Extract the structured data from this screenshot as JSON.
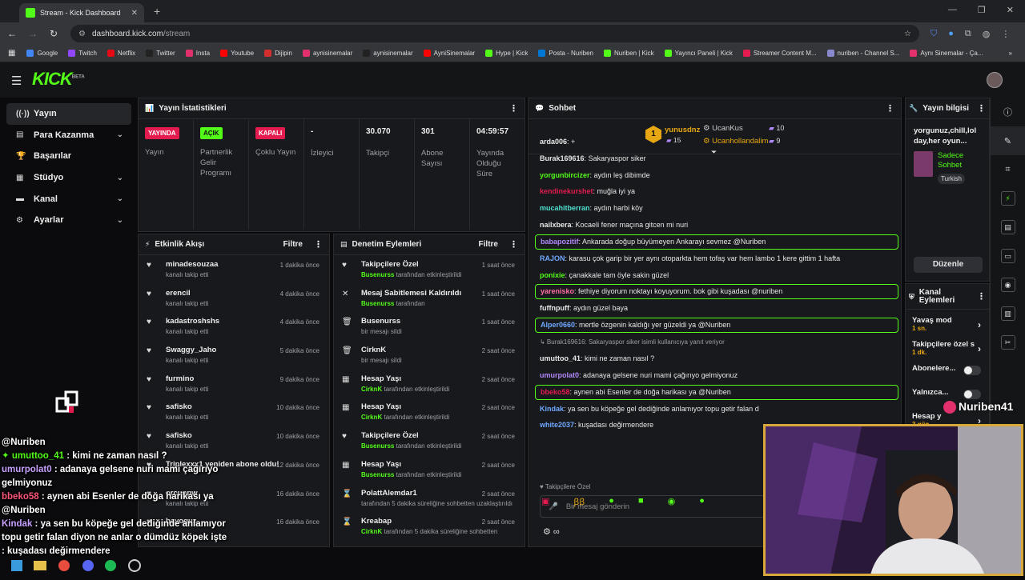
{
  "browser": {
    "tab_title": "Stream - Kick Dashboard",
    "url_host": "dashboard.kick.com",
    "url_path": "/stream",
    "bookmarks": [
      {
        "label": "Google",
        "color": "#4285f4"
      },
      {
        "label": "Twitch",
        "color": "#9146ff"
      },
      {
        "label": "Netflix",
        "color": "#e50914"
      },
      {
        "label": "Twitter",
        "color": "#222222"
      },
      {
        "label": "Insta",
        "color": "#e1306c"
      },
      {
        "label": "Youtube",
        "color": "#ff0000"
      },
      {
        "label": "Dijipin",
        "color": "#d32f2f"
      },
      {
        "label": "aynisinemalar",
        "color": "#e1306c"
      },
      {
        "label": "aynisinemalar",
        "color": "#222222"
      },
      {
        "label": "AyniSinemalar",
        "color": "#ff0000"
      },
      {
        "label": "Hype | Kick",
        "color": "#53fc18"
      },
      {
        "label": "Posta - Nuriben",
        "color": "#0078d4"
      },
      {
        "label": "Nuriben | Kick",
        "color": "#53fc18"
      },
      {
        "label": "Yayıncı Paneli | Kick",
        "color": "#53fc18"
      },
      {
        "label": "Streamer Content M...",
        "color": "#e41b4f"
      },
      {
        "label": "nuriben - Channel S...",
        "color": "#8888cc"
      },
      {
        "label": "Aynı Sinemalar - Ça...",
        "color": "#e1306c"
      }
    ]
  },
  "app": {
    "logo": "KICK",
    "logo_sup": "BETA",
    "sidebar": [
      {
        "label": "Yayın",
        "icon": "broadcast-icon",
        "glyph": "((·))",
        "chevron": false,
        "active": true
      },
      {
        "label": "Para Kazanma",
        "icon": "money-icon",
        "glyph": "▤",
        "chevron": true
      },
      {
        "label": "Başarılar",
        "icon": "trophy-icon",
        "glyph": "🏆",
        "chevron": false
      },
      {
        "label": "Stüdyo",
        "icon": "studio-icon",
        "glyph": "▦",
        "chevron": true
      },
      {
        "label": "Kanal",
        "icon": "channel-icon",
        "glyph": "▬",
        "chevron": true
      },
      {
        "label": "Ayarlar",
        "icon": "gear-icon",
        "glyph": "⚙",
        "chevron": true
      }
    ]
  },
  "stats_panel": {
    "title": "Yayın İstatistikleri",
    "cells": [
      {
        "badge": "YAYINDA",
        "badge_color": "red",
        "label": "Yayın"
      },
      {
        "badge": "AÇIK",
        "badge_color": "green",
        "label": "Partnerlik Gelir Programı"
      },
      {
        "badge": "KAPALI",
        "badge_color": "red",
        "label": "Çoklu Yayın"
      },
      {
        "value": "-",
        "label": "İzleyici"
      },
      {
        "value": "30.070",
        "label": "Takipçi"
      },
      {
        "value": "301",
        "label": "Abone Sayısı"
      },
      {
        "value": "04:59:57",
        "label": "Yayında Olduğu Süre"
      }
    ]
  },
  "activity_feed": {
    "title": "Etkinlik Akışı",
    "filter_label": "Filtre",
    "items": [
      {
        "name": "minadesouzaa",
        "sub": "kanalı takip etti",
        "time": "1 dakika önce"
      },
      {
        "name": "erencil",
        "sub": "kanalı takip etti",
        "time": "4 dakika önce"
      },
      {
        "name": "kadastroshshs",
        "sub": "kanalı takip etti",
        "time": "4 dakika önce"
      },
      {
        "name": "Swaggy_Jaho",
        "sub": "kanalı takip etti",
        "time": "5 dakika önce"
      },
      {
        "name": "furmino",
        "sub": "kanalı takip etti",
        "time": "9 dakika önce"
      },
      {
        "name": "safisko",
        "sub": "kanalı takip etti",
        "time": "10 dakika önce"
      },
      {
        "name": "safisko",
        "sub": "kanalı takip etti",
        "time": "10 dakika önce"
      },
      {
        "name": "Triplexxx1 yeniden abone oldu!",
        "sub": "",
        "time": "12 dakika önce"
      },
      {
        "name": "orcunpw",
        "sub": "kanalı takip etti",
        "time": "16 dakika önce"
      },
      {
        "name": "bayoguz",
        "sub": "",
        "time": "16 dakika önce"
      }
    ]
  },
  "mod_actions": {
    "title": "Denetim Eylemleri",
    "filter_label": "Filtre",
    "items": [
      {
        "name": "Takipçilere Özel",
        "actor": "Busenurss",
        "sub": "tarafından etkinleştirildi",
        "time": "1 saat önce",
        "glyph": "♥",
        "icon": "heart-icon"
      },
      {
        "name": "Mesaj Sabitlemesi Kaldırıldı",
        "actor": "Busenurss",
        "sub": "tarafından",
        "time": "1 saat önce",
        "glyph": "✕",
        "icon": "unpin-icon"
      },
      {
        "name": "Busenurss",
        "actor": "",
        "sub": "bir mesajı sildi",
        "time": "1 saat önce",
        "glyph": "🗑",
        "icon": "trash-icon"
      },
      {
        "name": "CirknK",
        "actor": "",
        "sub": "bir mesajı sildi",
        "time": "2 saat önce",
        "glyph": "🗑",
        "icon": "trash-icon"
      },
      {
        "name": "Hesap Yaşı",
        "actor": "CirknK",
        "sub": "tarafından etkinleştirildi",
        "time": "2 saat önce",
        "glyph": "▦",
        "icon": "calendar-icon"
      },
      {
        "name": "Hesap Yaşı",
        "actor": "CirknK",
        "sub": "tarafından etkinleştirildi",
        "time": "2 saat önce",
        "glyph": "▦",
        "icon": "calendar-icon"
      },
      {
        "name": "Takipçilere Özel",
        "actor": "Busenurss",
        "sub": "tarafından etkinleştirildi",
        "time": "2 saat önce",
        "glyph": "♥",
        "icon": "heart-icon"
      },
      {
        "name": "Hesap Yaşı",
        "actor": "Busenurss",
        "sub": "tarafından etkinleştirildi",
        "time": "2 saat önce",
        "glyph": "▦",
        "icon": "calendar-icon"
      },
      {
        "name": "PolattAlemdar1",
        "actor": "",
        "sub": "tarafından 5 dakika süreliğine sohbetten uzaklaştırıldı",
        "time": "2 saat önce",
        "glyph": "⌛",
        "icon": "hourglass-icon"
      },
      {
        "name": "Kreabap",
        "actor": "CirknK",
        "sub": "tarafından 5 dakika süreliğine sohbetten",
        "time": "2 saat önce",
        "glyph": "⌛",
        "icon": "hourglass-icon"
      }
    ]
  },
  "chat": {
    "title": "Sohbet",
    "gifters": [
      {
        "name": "yunusdnz",
        "count": "15",
        "rank": "1"
      },
      {
        "name": "UcanKus",
        "count": "10"
      },
      {
        "name": "Ucanhollandalim",
        "count": "9"
      }
    ],
    "messages": [
      {
        "user": "arda006",
        "text": "+",
        "color": "#e7e7e7",
        "hl": false
      },
      {
        "user": "Burak169616",
        "text": "Sakaryaspor siker",
        "color": "#e7e7e7",
        "hl": false
      },
      {
        "user": "yorgunbircizer",
        "text": "aydın leş dibimde",
        "color": "#53fc18",
        "hl": false
      },
      {
        "user": "kendinekurshet",
        "text": "muğla iyi ya",
        "color": "#e41b4f",
        "hl": false
      },
      {
        "user": "mucahitberran",
        "text": "aydın harbi köy",
        "color": "#4ee0d0",
        "hl": false
      },
      {
        "user": "nailxbera",
        "text": "Kocaeli fener maçına gitcen mi nuri",
        "color": "#e7e7e7",
        "hl": false
      },
      {
        "user": "babapozitif",
        "text": "Ankarada doğup büyümeyen Ankarayı sevmez @Nuriben",
        "color": "#b088f9",
        "hl": true
      },
      {
        "user": "RAJON",
        "text": "karasu çok garip bir yer aynı otoparkta hem tofaş var hem lambo 1 kere gittim 1 hafta",
        "color": "#6fa8ff",
        "hl": false
      },
      {
        "user": "ponixie",
        "text": "çanakkale tam öyle sakin güzel",
        "color": "#53fc18",
        "hl": false
      },
      {
        "user": "yarenisko",
        "text": "fethiye diyorum noktayı koyuyorum. bok gibi kuşadası @nuriben",
        "color": "#ff6fa8",
        "hl": true
      },
      {
        "user": "fuffnpuff",
        "text": "aydın güzel baya",
        "color": "#e7e7e7",
        "hl": false
      },
      {
        "user": "Alper0660",
        "text": "mertle özgenin kaldığı yer güzeldi ya @Nuriben",
        "color": "#6fa8ff",
        "hl": true
      },
      {
        "user": "",
        "text": "↳ Burak169616: Sakaryaspor siker isimli kullanıcıya yanıt veriyor",
        "color": "#9aa0a6",
        "hl": false
      },
      {
        "user": "umuttoo_41",
        "text": "kimi ne zaman nasıl ?",
        "color": "#e7e7e7",
        "hl": false
      },
      {
        "user": "umurpolat0",
        "text": "adanaya gelsene nuri mami çağırıyo gelmiyonuz",
        "color": "#b088f9",
        "hl": false
      },
      {
        "user": "bbeko58",
        "text": "aynen abi Esenler de doğa harikası ya @Nuriben",
        "color": "#e41b4f",
        "hl": true
      },
      {
        "user": "Kindak",
        "text": "ya sen bu köpeğe gel dediğinde anlamıyor topu getir falan d",
        "color": "#6fa8ff",
        "hl": false
      },
      {
        "user": "white2037",
        "text": "kuşadası değirmendere",
        "color": "#6fa8ff",
        "hl": false
      }
    ],
    "followers_only": "Takipçilere Özel",
    "input_placeholder": "Bir mesaj gönderin"
  },
  "stream_info": {
    "title": "Yayın bilgisi",
    "stream_title": "yorgunuz,chill,lol day,her oyun...",
    "category": "Sadece Sohbet",
    "language": "Turkish",
    "edit_label": "Düzenle"
  },
  "channel_actions": {
    "title": "Kanal Eylemleri",
    "items": [
      {
        "label": "Yavaş mod",
        "value": "1 sn.",
        "type": "arrow"
      },
      {
        "label": "Takipçilere özel s",
        "value": "1 dk.",
        "type": "arrow"
      },
      {
        "label": "Abonelere...",
        "value": "",
        "type": "toggle"
      },
      {
        "label": "Yalnızca...",
        "value": "",
        "type": "toggle"
      },
      {
        "label": "Hesap y",
        "value": "3 gün",
        "type": "arrow"
      }
    ]
  },
  "webcam": {
    "watermark": "Nuriben41"
  },
  "overlay_chat": [
    {
      "user": "@Nuriben",
      "text": "",
      "color": "#ffffff"
    },
    {
      "user": "umuttoo_41",
      "text": " : kimi ne zaman nasıl ?",
      "color": "#53fc18",
      "prefix": "✦ "
    },
    {
      "user": "umurpolat0",
      "text": " : adanaya gelsene nuri mami çağırıyo gelmiyonuz",
      "color": "#c8a0ff"
    },
    {
      "user": "bbeko58",
      "text": " : aynen abi Esenler de doğa harikası ya @Nuriben",
      "color": "#ff5577"
    },
    {
      "user": "Kindak",
      "text": " : ya sen bu köpeğe gel dediğinde anlamıyor topu getir falan diyon ne anlar o dümdüz köpek işte",
      "color": "#c8a0ff"
    },
    {
      "user": "",
      "text": ": kuşadası değirmendere",
      "color": "#ffffff"
    }
  ],
  "colors": {
    "accent": "#53fc18",
    "live": "#e41b4f",
    "panel": "#18191c",
    "bg": "#0b0b0d"
  }
}
